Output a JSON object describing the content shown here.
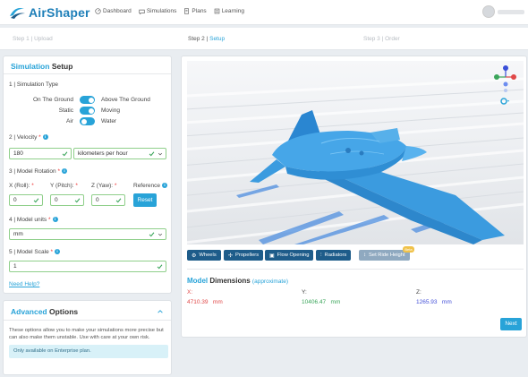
{
  "brand": {
    "name": "AirShaper",
    "accent": "#28a3d8",
    "dark": "#1e5c8a"
  },
  "nav": [
    {
      "icon": "dashboard-icon",
      "label": "Dashboard"
    },
    {
      "icon": "simulations-icon",
      "label": "Simulations"
    },
    {
      "icon": "plans-icon",
      "label": "Plans"
    },
    {
      "icon": "learning-icon",
      "label": "Learning"
    }
  ],
  "steps": {
    "step1": {
      "prefix": "Step 1 |",
      "name": "Upload"
    },
    "step2": {
      "prefix": "Step 2 |",
      "name": "Setup"
    },
    "step3": {
      "prefix": "Step 3 |",
      "name": "Order"
    }
  },
  "setup": {
    "title_hl": "Simulation",
    "title_rest": "Setup",
    "type": {
      "label": "1 | Simulation Type",
      "rows": [
        {
          "left": "On The Ground",
          "right": "Above The Ground",
          "state": "on"
        },
        {
          "left": "Static",
          "right": "Moving",
          "state": "on"
        },
        {
          "left": "Air",
          "right": "Water",
          "state": "off"
        }
      ]
    },
    "velocity": {
      "label": "2 | Velocity",
      "value": "180",
      "unit": "kilometers per hour"
    },
    "rotation": {
      "label": "3 | Model Rotation",
      "x_label": "X (Roll):",
      "x_value": "0",
      "y_label": "Y (Pitch):",
      "y_value": "0",
      "z_label": "Z (Yaw):",
      "z_value": "0",
      "reference_label": "Reference",
      "reset_label": "Reset"
    },
    "units": {
      "label": "4 | Model units",
      "value": "mm"
    },
    "scale": {
      "label": "5 | Model Scale",
      "value": "1"
    },
    "help_link": "Need Help?"
  },
  "advanced": {
    "title_hl": "Advanced",
    "title_rest": "Options",
    "description": "These options allow you to make your simulations more precise but can also make them unstable. Use with care at your own risk.",
    "notice": "Only available on Enterprise plan."
  },
  "viewer": {
    "buttons": [
      {
        "icon": "wheels-icon",
        "label": "Wheels"
      },
      {
        "icon": "propellers-icon",
        "label": "Propellers"
      },
      {
        "icon": "flow-opening-icon",
        "label": "Flow Opening"
      },
      {
        "icon": "radiators-icon",
        "label": "Radiators"
      },
      {
        "icon": "ride-height-icon",
        "label": "Set Ride Height"
      }
    ],
    "beta_label": "Beta",
    "model_color": "#3b9bdf"
  },
  "dimensions": {
    "title_hl": "Model",
    "title_rest": "Dimensions",
    "subtitle": "(approximate)",
    "x": {
      "label": "X:",
      "value": "4710.39",
      "unit": "mm",
      "color": "#e04848"
    },
    "y": {
      "label": "Y:",
      "value": "10406.47",
      "unit": "mm",
      "color": "#3aa55a"
    },
    "z": {
      "label": "Z:",
      "value": "1265.93",
      "unit": "mm",
      "color": "#4450d8"
    }
  },
  "next_label": "Next"
}
